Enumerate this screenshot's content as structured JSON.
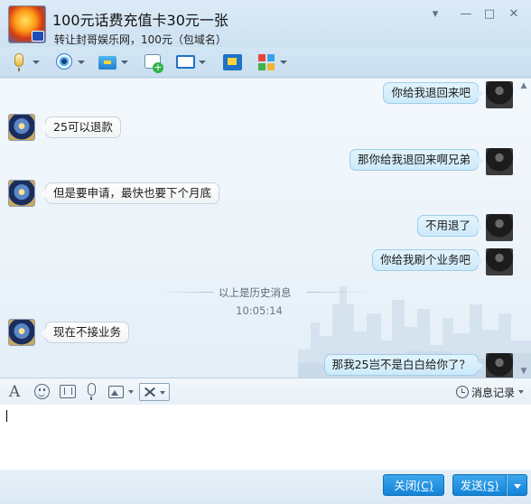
{
  "header": {
    "title": "100元话费充值卡30元一张",
    "subtitle": "转让封哥娱乐网，100元（包域名）"
  },
  "window_buttons": [
    "▾",
    "—",
    "□",
    "✕"
  ],
  "toolbar_icons": [
    "microphone-icon",
    "video-camera-icon",
    "file-transfer-icon",
    "add-member-icon",
    "remote-desktop-icon",
    "screen-share-icon",
    "apps-icon"
  ],
  "messages": [
    {
      "sender": "me",
      "text": "你给我退回来吧"
    },
    {
      "sender": "them",
      "text": "25可以退款"
    },
    {
      "sender": "me",
      "text": "那你给我退回来啊兄弟"
    },
    {
      "sender": "them",
      "text": "但是要申请，最快也要下个月底"
    },
    {
      "sender": "me",
      "text": "不用退了"
    },
    {
      "sender": "me",
      "text": "你给我刷个业务吧"
    },
    {
      "sender": "them",
      "text": "现在不接业务"
    },
    {
      "sender": "me",
      "text": "那我25岂不是白白给你了？"
    }
  ],
  "history_divider": "以上是历史消息",
  "timestamp": "10:05:14",
  "input_toolbar": {
    "icons": [
      "font-icon",
      "emoji-icon",
      "gif-icon",
      "voice-message-icon",
      "image-icon",
      "screenshot-scissors-icon"
    ],
    "history_label": "消息记录"
  },
  "input": {
    "value": ""
  },
  "buttons": {
    "close": "关闭",
    "close_key": "(C)",
    "send": "发送",
    "send_key": "(S)"
  },
  "colors": {
    "accent": "#1f8ae0",
    "bubble_mine": "#d6eefc",
    "bubble_theirs": "#ffffff"
  }
}
